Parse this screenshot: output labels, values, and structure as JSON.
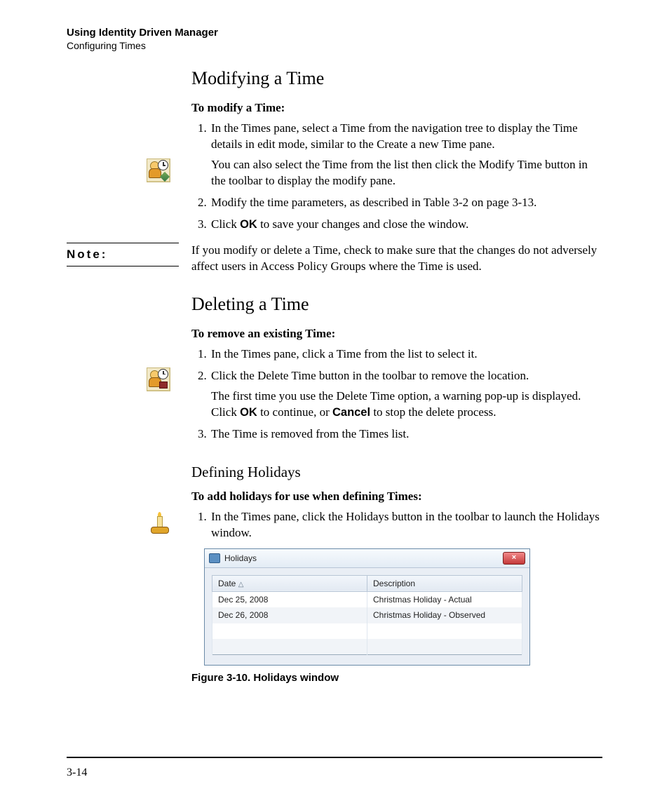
{
  "header": {
    "title": "Using Identity Driven Manager",
    "subtitle": "Configuring Times"
  },
  "modify": {
    "heading": "Modifying a Time",
    "lead": "To modify a Time:",
    "step1": "In the Times pane, select a Time from the navigation tree to display the Time details in edit mode, similar to the Create a new Time pane.",
    "step1_note": "You can also select the Time from the list then click the Modify Time button in the toolbar to display the modify pane.",
    "step2": "Modify the time parameters, as described in Table 3-2 on page 3-13.",
    "step3_pre": "Click ",
    "step3_bold": "OK",
    "step3_post": " to save your changes and close the window."
  },
  "note": {
    "label": "Note:",
    "text": "If you modify or delete a Time, check to make sure that the changes do not adversely affect users in Access Policy Groups where the Time is used."
  },
  "delete": {
    "heading": "Deleting a Time",
    "lead": "To remove an existing Time:",
    "step1": "In the Times pane, click a Time from the list to select it.",
    "step2": "Click the Delete Time button in the toolbar to remove the location.",
    "step2_note_pre": "The first time you use the Delete Time option, a warning pop-up is displayed. Click ",
    "step2_note_b1": "OK",
    "step2_note_mid": " to continue, or ",
    "step2_note_b2": "Cancel",
    "step2_note_post": " to stop the delete process.",
    "step3": "The Time is removed from the Times list."
  },
  "holidays": {
    "heading": "Defining Holidays",
    "lead": "To add holidays for use when defining Times:",
    "step1": "In the Times pane, click the Holidays button in the toolbar to launch the Holidays window.",
    "fig_caption": "Figure 3-10. Holidays window"
  },
  "holiday_window": {
    "title": "Holidays",
    "close": "×",
    "col_date": "Date",
    "col_desc": "Description",
    "rows": [
      {
        "date": "Dec 25, 2008",
        "desc": "Christmas Holiday - Actual"
      },
      {
        "date": "Dec 26, 2008",
        "desc": "Christmas Holiday - Observed"
      }
    ]
  },
  "footer": {
    "page": "3-14"
  }
}
